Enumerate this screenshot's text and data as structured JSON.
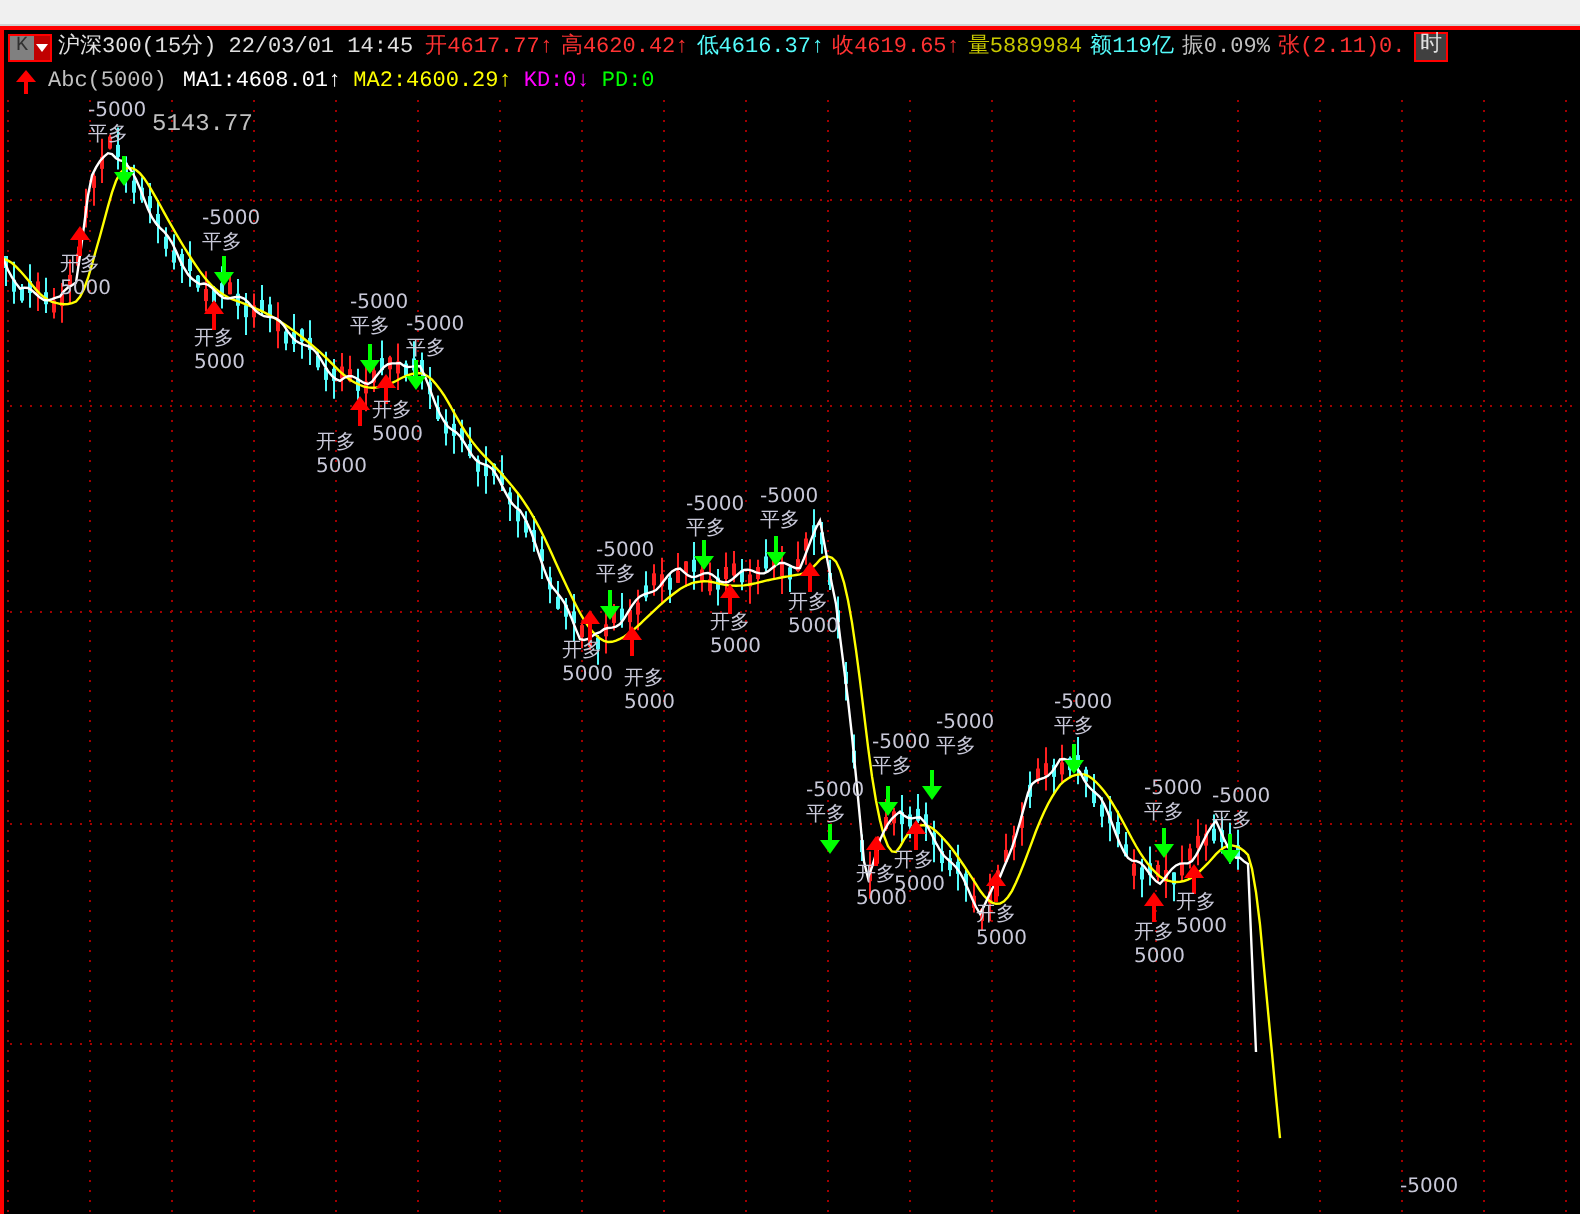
{
  "quote_bar": {
    "period_button": "K",
    "symbol": "沪深300(15分)",
    "datetime": "22/03/01 14:45",
    "fields": [
      {
        "text": "开4617.77↑",
        "color": "#ff3232"
      },
      {
        "text": "高4620.42↑",
        "color": "#ff3232"
      },
      {
        "text": "低4616.37↑",
        "color": "#54fcfc"
      },
      {
        "text": "收4619.65↑",
        "color": "#ff3232"
      },
      {
        "text": "量5889984",
        "color": "#c8c800"
      },
      {
        "text": "额119亿",
        "color": "#54fcfc"
      },
      {
        "text": "振0.09%",
        "color": "#c0c0c0"
      },
      {
        "text": "张(2.11)0.",
        "color": "#ff3232"
      }
    ],
    "time_button": "时"
  },
  "indicator_bar": {
    "rising": true,
    "formula": "Abc(5000)",
    "fields": [
      {
        "text": "MA1:4608.01↑",
        "color": "#ffffff"
      },
      {
        "text": "MA2:4600.29↑",
        "color": "#ffff00"
      },
      {
        "text": "KD:0↓",
        "color": "#ff00ff"
      },
      {
        "text": "PD:0",
        "color": "#00ff00"
      }
    ]
  },
  "chart": {
    "max_label": "5143.77",
    "signals": [
      {
        "kind": "close",
        "amount": "-5000",
        "action": "平多"
      },
      {
        "kind": "open",
        "amount": "5000",
        "action": "开多"
      },
      {
        "kind": "close",
        "amount": "-5000",
        "action": "平多"
      },
      {
        "kind": "open",
        "amount": "5000",
        "action": "开多"
      },
      {
        "kind": "close",
        "amount": "-5000",
        "action": "平多"
      },
      {
        "kind": "open",
        "amount": "5000",
        "action": "开多"
      },
      {
        "kind": "close",
        "amount": "-5000",
        "action": "平多"
      },
      {
        "kind": "open",
        "amount": "5000",
        "action": "开多"
      },
      {
        "kind": "close",
        "amount": "-5000",
        "action": "平多"
      },
      {
        "kind": "open",
        "amount": "5000",
        "action": "开多"
      },
      {
        "kind": "open",
        "amount": "5000",
        "action": "开多"
      },
      {
        "kind": "close",
        "amount": "-5000",
        "action": "平多"
      },
      {
        "kind": "open",
        "amount": "5000",
        "action": "开多"
      },
      {
        "kind": "close",
        "amount": "-5000",
        "action": "平多"
      },
      {
        "kind": "open",
        "amount": "5000",
        "action": "开多"
      },
      {
        "kind": "close",
        "amount": "-5000",
        "action": "平多"
      },
      {
        "kind": "open",
        "amount": "5000",
        "action": "开多"
      },
      {
        "kind": "close",
        "amount": "-5000",
        "action": "平多"
      },
      {
        "kind": "open",
        "amount": "5000",
        "action": "开多"
      },
      {
        "kind": "close",
        "amount": "-5000",
        "action": "平多"
      },
      {
        "kind": "open",
        "amount": "5000",
        "action": "开多"
      },
      {
        "kind": "close",
        "amount": "-5000",
        "action": "平多"
      },
      {
        "kind": "open",
        "amount": "5000",
        "action": "开多"
      },
      {
        "kind": "close",
        "amount": "-5000",
        "action": "平多"
      },
      {
        "kind": "open",
        "amount": "5000",
        "action": "开多"
      },
      {
        "kind": "close",
        "amount": "-5000",
        "action": "平多"
      },
      {
        "kind": "close",
        "amount": "-5000"
      }
    ]
  }
}
